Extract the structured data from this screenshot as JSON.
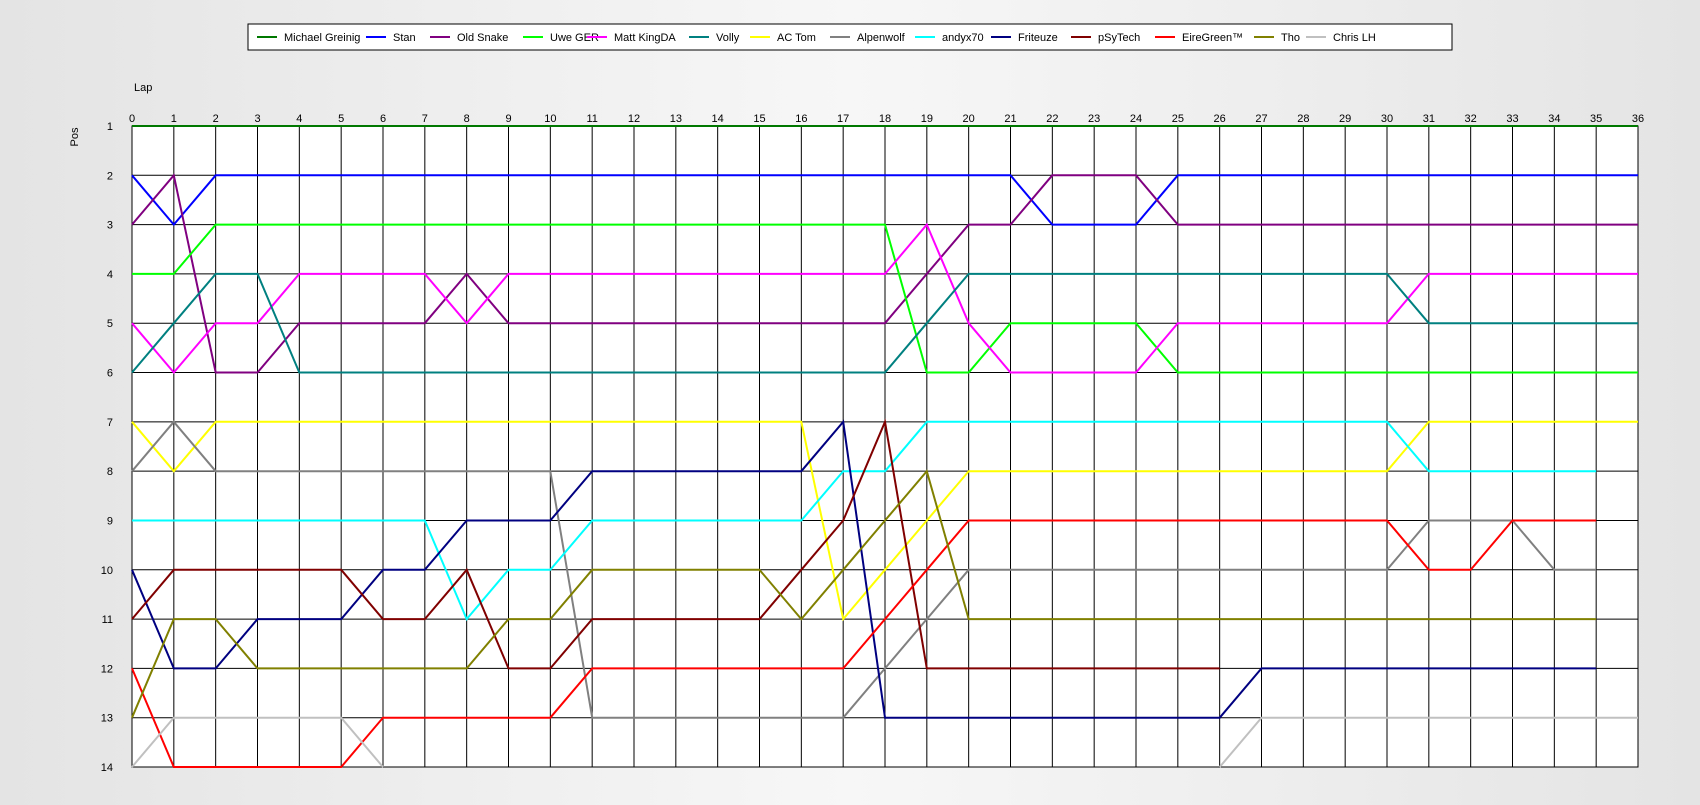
{
  "chart_data": {
    "type": "line",
    "x_axis_label": "Lap",
    "y_axis_label": "Pos",
    "x_range": [
      0,
      36
    ],
    "y_range": [
      1,
      14
    ],
    "y_inverted": true,
    "grid": true,
    "legend_position": "top",
    "x_ticks": [
      0,
      1,
      2,
      3,
      4,
      5,
      6,
      7,
      8,
      9,
      10,
      11,
      12,
      13,
      14,
      15,
      16,
      17,
      18,
      19,
      20,
      21,
      22,
      23,
      24,
      25,
      26,
      27,
      28,
      29,
      30,
      31,
      32,
      33,
      34,
      35,
      36
    ],
    "y_ticks": [
      1,
      2,
      3,
      4,
      5,
      6,
      7,
      8,
      9,
      10,
      11,
      12,
      13,
      14
    ],
    "series": [
      {
        "name": "Michael Greinig",
        "color": "#007800",
        "values": [
          1,
          1,
          1,
          1,
          1,
          1,
          1,
          1,
          1,
          1,
          1,
          1,
          1,
          1,
          1,
          1,
          1,
          1,
          1,
          1,
          1,
          1,
          1,
          1,
          1,
          1,
          1,
          1,
          1,
          1,
          1,
          1,
          1,
          1,
          1,
          1,
          1
        ]
      },
      {
        "name": "Stan",
        "color": "#0000ff",
        "values": [
          2,
          3,
          2,
          2,
          2,
          2,
          2,
          2,
          2,
          2,
          2,
          2,
          2,
          2,
          2,
          2,
          2,
          2,
          2,
          2,
          2,
          2,
          3,
          3,
          3,
          2,
          2,
          2,
          2,
          2,
          2,
          2,
          2,
          2,
          2,
          2,
          2
        ]
      },
      {
        "name": "Old Snake",
        "color": "#800080",
        "values": [
          3,
          2,
          6,
          6,
          5,
          5,
          5,
          5,
          4,
          5,
          5,
          5,
          5,
          5,
          5,
          5,
          5,
          5,
          5,
          4,
          3,
          3,
          2,
          2,
          2,
          3,
          3,
          3,
          3,
          3,
          3,
          3,
          3,
          3,
          3,
          3,
          3
        ]
      },
      {
        "name": "Uwe GER",
        "color": "#00ff00",
        "values": [
          4,
          4,
          3,
          3,
          3,
          3,
          3,
          3,
          3,
          3,
          3,
          3,
          3,
          3,
          3,
          3,
          3,
          3,
          3,
          6,
          6,
          5,
          5,
          5,
          5,
          6,
          6,
          6,
          6,
          6,
          6,
          6,
          6,
          6,
          6,
          6,
          6
        ]
      },
      {
        "name": "Matt KingDA",
        "color": "#ff00ff",
        "values": [
          5,
          6,
          5,
          5,
          4,
          4,
          4,
          4,
          5,
          4,
          4,
          4,
          4,
          4,
          4,
          4,
          4,
          4,
          4,
          3,
          5,
          6,
          6,
          6,
          6,
          5,
          5,
          5,
          5,
          5,
          5,
          4,
          4,
          4,
          4,
          4,
          4
        ]
      },
      {
        "name": "Volly",
        "color": "#008080",
        "values": [
          6,
          5,
          4,
          4,
          6,
          6,
          6,
          6,
          6,
          6,
          6,
          6,
          6,
          6,
          6,
          6,
          6,
          6,
          6,
          5,
          4,
          4,
          4,
          4,
          4,
          4,
          4,
          4,
          4,
          4,
          4,
          5,
          5,
          5,
          5,
          5,
          5
        ]
      },
      {
        "name": "AC Tom",
        "color": "#ffff00",
        "values": [
          7,
          8,
          7,
          7,
          7,
          7,
          7,
          7,
          7,
          7,
          7,
          7,
          7,
          7,
          7,
          7,
          7,
          11,
          10,
          9,
          8,
          8,
          8,
          8,
          8,
          8,
          8,
          8,
          8,
          8,
          8,
          7,
          7,
          7,
          7,
          7,
          7
        ]
      },
      {
        "name": "Alpenwolf",
        "color": "#808080",
        "values": [
          8,
          7,
          8,
          8,
          8,
          8,
          8,
          8,
          8,
          8,
          8,
          13,
          13,
          13,
          13,
          13,
          13,
          13,
          12,
          11,
          10,
          10,
          10,
          10,
          10,
          10,
          10,
          10,
          10,
          10,
          10,
          9,
          9,
          9,
          10,
          10
        ]
      },
      {
        "name": "andyx70",
        "color": "#00ffff",
        "values": [
          9,
          9,
          9,
          9,
          9,
          9,
          9,
          9,
          11,
          10,
          10,
          9,
          9,
          9,
          9,
          9,
          9,
          8,
          8,
          7,
          7,
          7,
          7,
          7,
          7,
          7,
          7,
          7,
          7,
          7,
          7,
          8,
          8,
          8,
          8,
          8
        ]
      },
      {
        "name": "Friteuze",
        "color": "#000080",
        "values": [
          10,
          12,
          12,
          11,
          11,
          11,
          10,
          10,
          9,
          9,
          9,
          8,
          8,
          8,
          8,
          8,
          8,
          7,
          13,
          13,
          13,
          13,
          13,
          13,
          13,
          13,
          13,
          12,
          12,
          12,
          12,
          12,
          12,
          12,
          12,
          12
        ]
      },
      {
        "name": "pSyTech",
        "color": "#800000",
        "values": [
          11,
          10,
          10,
          10,
          10,
          10,
          11,
          11,
          10,
          12,
          12,
          11,
          11,
          11,
          11,
          11,
          10,
          9,
          7,
          12,
          12,
          12,
          12,
          12,
          12,
          12,
          12
        ]
      },
      {
        "name": "EireGreen™",
        "color": "#ff0000",
        "values": [
          12,
          14,
          14,
          14,
          14,
          14,
          13,
          13,
          13,
          13,
          13,
          12,
          12,
          12,
          12,
          12,
          12,
          12,
          11,
          10,
          9,
          9,
          9,
          9,
          9,
          9,
          9,
          9,
          9,
          9,
          9,
          10,
          10,
          9,
          9,
          9
        ]
      },
      {
        "name": "Tho",
        "color": "#808000",
        "values": [
          13,
          11,
          11,
          12,
          12,
          12,
          12,
          12,
          12,
          11,
          11,
          10,
          10,
          10,
          10,
          10,
          11,
          10,
          9,
          8,
          11,
          11,
          11,
          11,
          11,
          11,
          11,
          11,
          11,
          11,
          11,
          11,
          11,
          11,
          11,
          11
        ]
      },
      {
        "name": "Chris LH",
        "color": "#c0c0c0",
        "values": [
          14,
          13,
          13,
          13,
          13,
          13,
          14,
          null,
          null,
          null,
          null,
          null,
          null,
          null,
          null,
          null,
          null,
          null,
          null,
          null,
          null,
          null,
          null,
          null,
          null,
          null,
          14,
          13,
          13,
          13,
          13,
          13,
          13,
          13,
          13,
          13,
          13
        ]
      }
    ]
  }
}
